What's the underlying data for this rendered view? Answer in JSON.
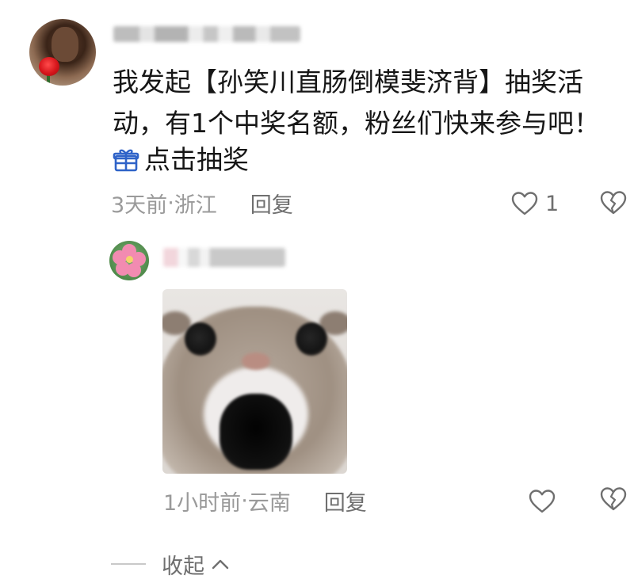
{
  "comment": {
    "author_name": "",
    "text": "我发起【孙笑川直肠倒模斐济背】抽奖活动，有1个中奖名额，粉丝们快来参与吧！",
    "lottery_link": "点击抽奖",
    "time": "3天前",
    "separator": " · ",
    "location": "浙江",
    "reply_label": "回复",
    "like_count": "1"
  },
  "reply": {
    "author_name": "",
    "time": "1小时前",
    "separator": " · ",
    "location": "云南",
    "reply_label": "回复"
  },
  "collapse": {
    "label": "收起"
  },
  "colors": {
    "text": "#161616",
    "meta": "#9a9a9a",
    "gift_icon": "#2f63c8",
    "icon_gray": "#6f6f6f"
  }
}
